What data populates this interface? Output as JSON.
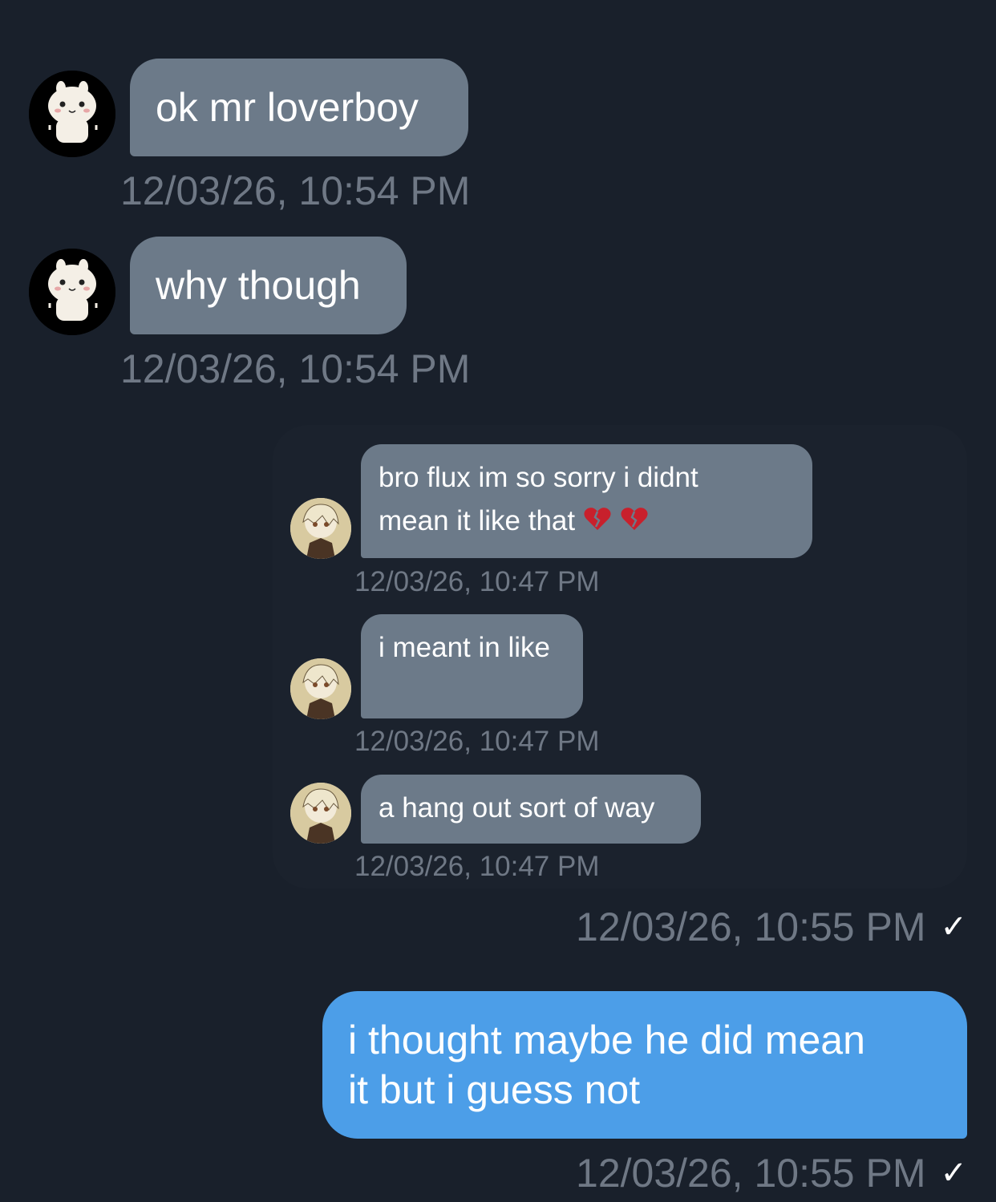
{
  "messages_in": [
    {
      "text": "ok mr loverboy",
      "time": "12/03/26, 10:54 PM"
    },
    {
      "text": "why though",
      "time": "12/03/26, 10:54 PM"
    }
  ],
  "quoted": {
    "messages": [
      {
        "text_line1": "bro flux im so sorry i didnt",
        "text_line2": "mean it like that",
        "emoji": "💔 💔",
        "time": "12/03/26, 10:47 PM"
      },
      {
        "text": "i meant in like",
        "time": "12/03/26, 10:47 PM"
      },
      {
        "text": "a hang out sort of way",
        "time": "12/03/26, 10:47 PM"
      }
    ],
    "time": "12/03/26, 10:55 PM",
    "status": "✓"
  },
  "message_out": {
    "line1": "i thought maybe he did mean",
    "line2": "it but i guess not",
    "time": "12/03/26, 10:55 PM",
    "status": "✓"
  },
  "colors": {
    "background": "#19202b",
    "incoming_bubble": "#6c7a89",
    "outgoing_bubble": "#4c9ee8",
    "timestamp": "#6f7885"
  }
}
